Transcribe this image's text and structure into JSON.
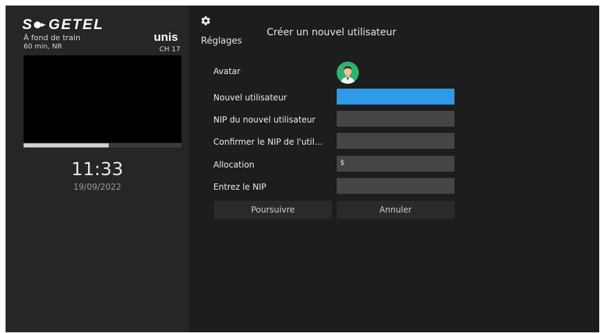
{
  "brand": {
    "logo_prefix": "S",
    "logo_suffix": "GETEL"
  },
  "now_playing": {
    "title": "À fond de train",
    "meta": "60 min, NR",
    "channel_name": "unis",
    "channel_number": "CH 17",
    "progress_fraction": 0.54
  },
  "clock": {
    "time": "11:33",
    "date": "19/09/2022"
  },
  "header": {
    "settings_label": "Réglages",
    "page_title": "Créer un nouvel utilisateur"
  },
  "form": {
    "avatar_label": "Avatar",
    "new_user_label": "Nouvel utilisateur",
    "new_user_value": "",
    "new_pin_label": "NIP du nouvel utilisateur",
    "new_pin_value": "",
    "confirm_pin_label": "Confirmer le NIP de l'util…",
    "confirm_pin_value": "",
    "allocation_label": "Allocation",
    "allocation_value": "$",
    "enter_pin_label": "Entrez le NIP",
    "enter_pin_value": ""
  },
  "actions": {
    "continue_label": "Poursuivre",
    "cancel_label": "Annuler"
  },
  "colors": {
    "accent": "#2e9bea",
    "avatar_bg": "#2eb36d",
    "panel_bg": "#262626",
    "screen_bg": "#1d1d1d"
  },
  "icons": {
    "settings": "gear-icon",
    "avatar": "user-avatar-icon"
  }
}
